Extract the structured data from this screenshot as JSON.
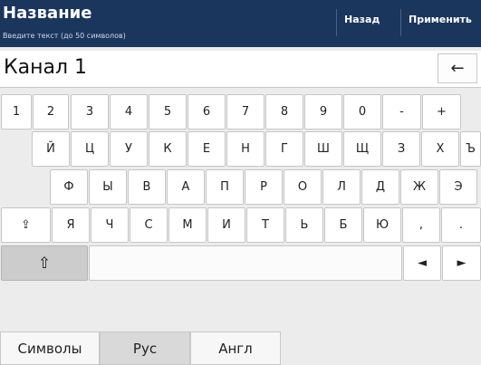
{
  "header": {
    "title": "Название",
    "subtitle": "Введите текст (до 50 символов)",
    "back_label": "Назад",
    "apply_label": "Применить"
  },
  "input": {
    "value": "Канал 1",
    "backspace_glyph": "←"
  },
  "keyboard": {
    "row1": [
      "1",
      "2",
      "3",
      "4",
      "5",
      "6",
      "7",
      "8",
      "9",
      "0",
      "-",
      "+"
    ],
    "row2": [
      "Й",
      "Ц",
      "У",
      "К",
      "Е",
      "Н",
      "Г",
      "Ш",
      "Щ",
      "З",
      "Х",
      "Ъ"
    ],
    "row3": [
      "Ф",
      "Ы",
      "В",
      "А",
      "П",
      "Р",
      "О",
      "Л",
      "Д",
      "Ж",
      "Э"
    ],
    "row4_shift_glyph": "⇪",
    "row4": [
      "Я",
      "Ч",
      "С",
      "М",
      "И",
      "Т",
      "Ь",
      "Б",
      "Ю",
      ",",
      "."
    ],
    "shift_glyph": "⇧",
    "left_arrow": "◄",
    "right_arrow": "►"
  },
  "tabs": {
    "symbols": "Символы",
    "rus": "Рус",
    "eng": "Англ"
  },
  "colors": {
    "header_bg": "#1b365d",
    "key_bg": "#ffffff",
    "key_dark_bg": "#cccccc",
    "page_bg": "#ececec"
  }
}
